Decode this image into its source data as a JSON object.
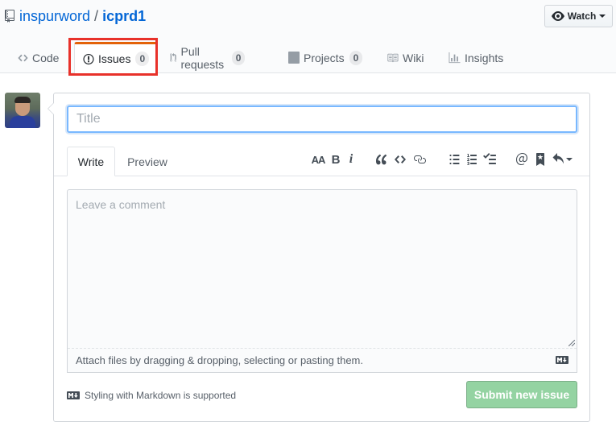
{
  "repo": {
    "owner": "inspurword",
    "separator": "/",
    "name": "icprd1"
  },
  "watch": {
    "label": "Watch"
  },
  "tabs": [
    {
      "label": "Code",
      "icon": "code-icon"
    },
    {
      "label": "Issues",
      "count": "0",
      "icon": "issue-opened-icon",
      "selected": true
    },
    {
      "label": "Pull requests",
      "count": "0",
      "icon": "git-pull-request-icon"
    },
    {
      "label": "Projects",
      "count": "0",
      "icon": "project-icon"
    },
    {
      "label": "Wiki",
      "icon": "book-icon"
    },
    {
      "label": "Insights",
      "icon": "graph-icon"
    }
  ],
  "highlight_color": "#e8312a",
  "form": {
    "title_placeholder": "Title",
    "write_tab": "Write",
    "preview_tab": "Preview",
    "toolbar": {
      "header": "AA",
      "bold": "B",
      "italic": "i",
      "icons": [
        "text-size-icon",
        "bold-icon",
        "italic-icon",
        "quote-icon",
        "code-icon",
        "link-icon",
        "list-unordered-icon",
        "list-ordered-icon",
        "tasklist-icon",
        "mention-icon",
        "bookmark-icon",
        "reply-icon"
      ]
    },
    "comment_placeholder": "Leave a comment",
    "attach_text": "Attach files by dragging & dropping, selecting or pasting them.",
    "markdown_note": "Styling with Markdown is supported",
    "submit_label": "Submit new issue",
    "submit_color": "#94d3a2"
  }
}
